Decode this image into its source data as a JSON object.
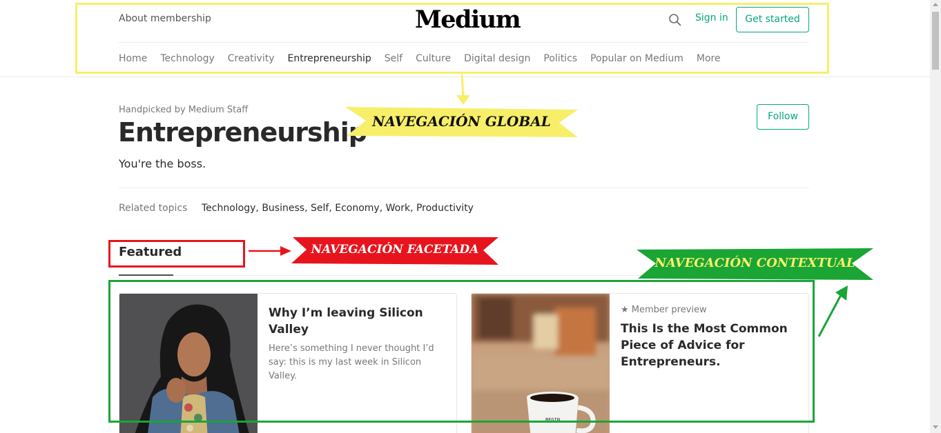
{
  "header": {
    "about": "About membership",
    "logo": "Medium",
    "search_icon": "search-icon",
    "signin": "Sign in",
    "get_started": "Get started",
    "nav": [
      "Home",
      "Technology",
      "Creativity",
      "Entrepreneurship",
      "Self",
      "Culture",
      "Digital design",
      "Politics",
      "Popular on Medium",
      "More"
    ],
    "active_nav": "Entrepreneurship"
  },
  "topic": {
    "handpicked": "Handpicked by Medium Staff",
    "title": "Entrepreneurship",
    "description": "You're the boss.",
    "follow": "Follow",
    "related_label": "Related topics",
    "related": [
      "Technology",
      "Business",
      "Self",
      "Economy",
      "Work",
      "Productivity"
    ]
  },
  "featured": {
    "heading": "Featured",
    "cards": [
      {
        "title": "Why I’m leaving Silicon Valley",
        "subtitle": "Here’s something I never thought I’d say: this is my last week in Silicon Valley.",
        "member": ""
      },
      {
        "title": "This Is the Most Common Piece of Advice for Entrepreneurs.",
        "subtitle": "",
        "member": "★ Member preview",
        "mug_text": "BEGIN."
      }
    ]
  },
  "annotations": {
    "global": "NAVEGACIÓN GLOBAL",
    "faceted": "NAVEGACIÓN FACETADA",
    "contextual": "NAVEGACIÓN CONTEXTUAL"
  },
  "colors": {
    "accent": "#03a87c",
    "global": "#f7ef6a",
    "faceted": "#e8141d",
    "contextual": "#1aa535"
  }
}
